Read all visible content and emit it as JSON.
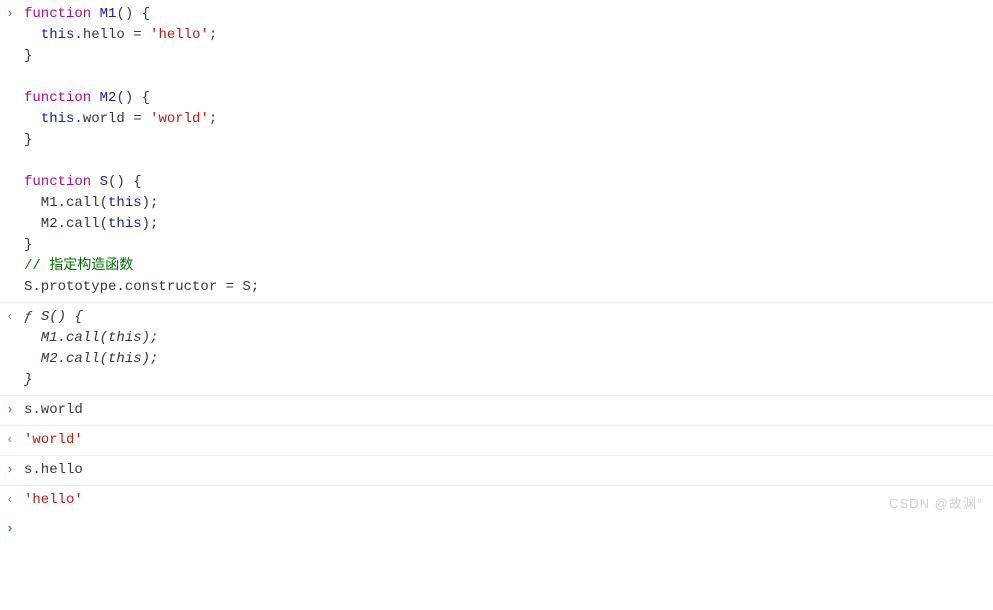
{
  "entries": [
    {
      "type": "input",
      "marker": "›",
      "lines": [
        [
          {
            "t": "function",
            "c": "kw-function"
          },
          {
            "t": " ",
            "c": ""
          },
          {
            "t": "M1",
            "c": "fn-name"
          },
          {
            "t": "() {",
            "c": "paren"
          }
        ],
        [
          {
            "t": "  ",
            "c": ""
          },
          {
            "t": "this",
            "c": "kw-this"
          },
          {
            "t": ".hello = ",
            "c": ""
          },
          {
            "t": "'hello'",
            "c": "string"
          },
          {
            "t": ";",
            "c": ""
          }
        ],
        [
          {
            "t": "}",
            "c": "paren"
          }
        ],
        [
          {
            "t": "",
            "c": ""
          }
        ],
        [
          {
            "t": "function",
            "c": "kw-function"
          },
          {
            "t": " ",
            "c": ""
          },
          {
            "t": "M2",
            "c": "fn-name"
          },
          {
            "t": "() {",
            "c": "paren"
          }
        ],
        [
          {
            "t": "  ",
            "c": ""
          },
          {
            "t": "this",
            "c": "kw-this"
          },
          {
            "t": ".world = ",
            "c": ""
          },
          {
            "t": "'world'",
            "c": "string"
          },
          {
            "t": ";",
            "c": ""
          }
        ],
        [
          {
            "t": "}",
            "c": "paren"
          }
        ],
        [
          {
            "t": "",
            "c": ""
          }
        ],
        [
          {
            "t": "function",
            "c": "kw-function"
          },
          {
            "t": " ",
            "c": ""
          },
          {
            "t": "S",
            "c": "fn-name"
          },
          {
            "t": "() {",
            "c": "paren"
          }
        ],
        [
          {
            "t": "  M1.call(",
            "c": ""
          },
          {
            "t": "this",
            "c": "kw-this"
          },
          {
            "t": ");",
            "c": ""
          }
        ],
        [
          {
            "t": "  M2.call(",
            "c": ""
          },
          {
            "t": "this",
            "c": "kw-this"
          },
          {
            "t": ");",
            "c": ""
          }
        ],
        [
          {
            "t": "}",
            "c": "paren"
          }
        ],
        [
          {
            "t": "// 指定构造函数",
            "c": "comment"
          }
        ],
        [
          {
            "t": "S.prototype.constructor = S;",
            "c": ""
          }
        ]
      ]
    },
    {
      "type": "output",
      "marker": "‹",
      "italic": true,
      "lines": [
        [
          {
            "t": "ƒ",
            "c": "fn-italic"
          },
          {
            "t": " ",
            "c": ""
          },
          {
            "t": "S() {",
            "c": "fn-italic"
          }
        ],
        [
          {
            "t": "  M1.call(this);",
            "c": "fn-italic"
          }
        ],
        [
          {
            "t": "  M2.call(this);",
            "c": "fn-italic"
          }
        ],
        [
          {
            "t": "}",
            "c": "fn-italic"
          }
        ]
      ]
    },
    {
      "type": "input",
      "marker": "›",
      "lines": [
        [
          {
            "t": "s.world",
            "c": ""
          }
        ]
      ]
    },
    {
      "type": "output",
      "marker": "‹",
      "lines": [
        [
          {
            "t": "'world'",
            "c": "output-string"
          }
        ]
      ]
    },
    {
      "type": "input",
      "marker": "›",
      "lines": [
        [
          {
            "t": "s.hello",
            "c": ""
          }
        ]
      ]
    },
    {
      "type": "output",
      "marker": "‹",
      "lines": [
        [
          {
            "t": "'hello'",
            "c": "output-string"
          }
        ]
      ]
    }
  ],
  "prompt_marker": "›",
  "watermark": "CSDN @故渊°"
}
